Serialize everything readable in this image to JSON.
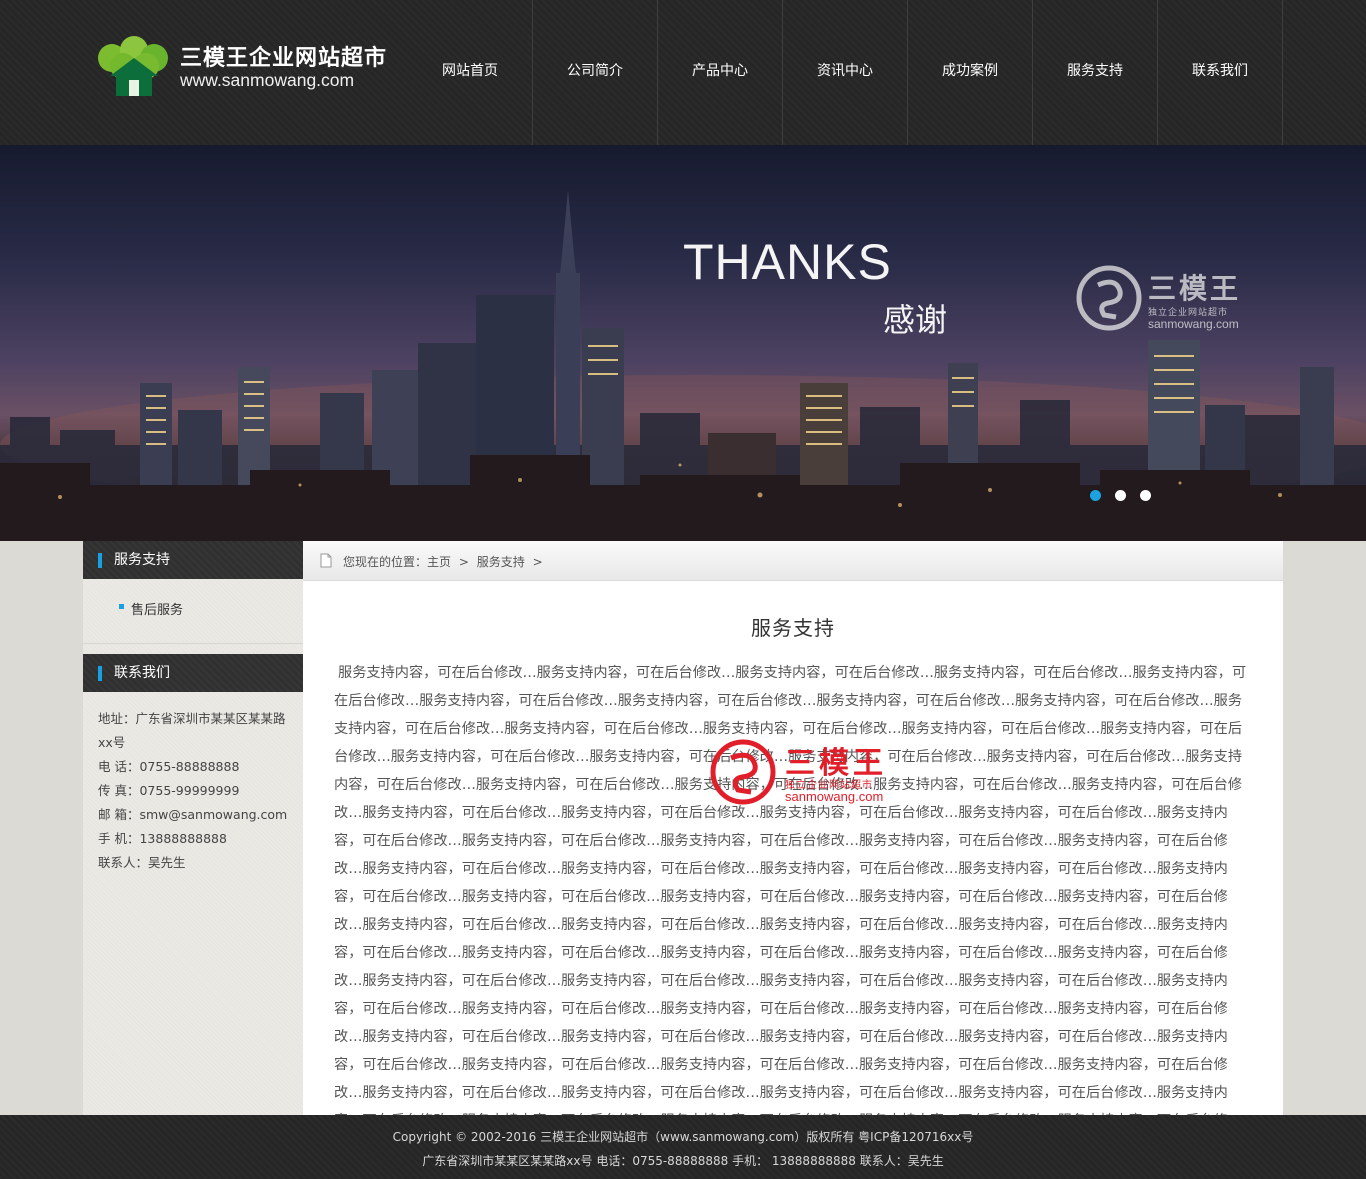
{
  "site": {
    "name_cn": "三模王企业网站超市",
    "url": "www.sanmowang.com"
  },
  "nav": {
    "items": [
      "网站首页",
      "公司简介",
      "产品中心",
      "资讯中心",
      "成功案例",
      "服务支持",
      "联系我们"
    ]
  },
  "banner": {
    "title": "THANKS",
    "subtitle": "感谢",
    "watermark": {
      "brand": "三模王",
      "tagline": "独立企业网站超市",
      "url": "sanmowang.com"
    },
    "slides": 3,
    "active_slide": 1
  },
  "sidebar": {
    "service_heading": "服务支持",
    "service_items": [
      "售后服务"
    ],
    "contact_heading": "联系我们",
    "contact": {
      "address": "地址：广东省深圳市某某区某某路xx号",
      "phone": "电 话：0755-88888888",
      "fax": "传 真：0755-99999999",
      "email": "邮 箱：smw@sanmowang.com",
      "mobile": "手 机：13888888888",
      "person": "联系人：吴先生"
    }
  },
  "breadcrumb": {
    "prefix": "您现在的位置：",
    "home": "主页",
    "sep": ">",
    "current": "服务支持",
    "trail": ">"
  },
  "content": {
    "title": "服务支持",
    "body": "服务支持内容，可在后台修改…服务支持内容，可在后台修改…服务支持内容，可在后台修改…服务支持内容，可在后台修改…服务支持内容，可在后台修改…服务支持内容，可在后台修改…服务支持内容，可在后台修改…服务支持内容，可在后台修改…服务支持内容，可在后台修改…服务支持内容，可在后台修改…服务支持内容，可在后台修改…服务支持内容，可在后台修改…服务支持内容，可在后台修改…服务支持内容，可在后台修改…服务支持内容，可在后台修改…服务支持内容，可在后台修改…服务支持内容，可在后台修改…服务支持内容，可在后台修改…服务支持内容，可在后台修改…服务支持内容，可在后台修改…服务支持内容，可在后台修改…服务支持内容，可在后台修改…服务支持内容，可在后台修改…服务支持内容，可在后台修改…服务支持内容，可在后台修改…服务支持内容，可在后台修改…服务支持内容，可在后台修改…服务支持内容，可在后台修改…服务支持内容，可在后台修改…服务支持内容，可在后台修改…服务支持内容，可在后台修改…服务支持内容，可在后台修改…服务支持内容，可在后台修改…服务支持内容，可在后台修改…服务支持内容，可在后台修改…服务支持内容，可在后台修改…服务支持内容，可在后台修改…服务支持内容，可在后台修改…服务支持内容，可在后台修改…服务支持内容，可在后台修改…服务支持内容，可在后台修改…服务支持内容，可在后台修改…服务支持内容，可在后台修改…服务支持内容，可在后台修改…服务支持内容，可在后台修改…服务支持内容，可在后台修改…服务支持内容，可在后台修改…服务支持内容，可在后台修改…服务支持内容，可在后台修改…服务支持内容，可在后台修改…服务支持内容，可在后台修改…服务支持内容，可在后台修改…服务支持内容，可在后台修改…服务支持内容，可在后台修改…服务支持内容，可在后台修改…服务支持内容，可在后台修改…服务支持内容，可在后台修改…服务支持内容，可在后台修改…服务支持内容，可在后台修改…服务支持内容，可在后台修改…服务支持内容，可在后台修改…服务支持内容，可在后台修改…服务支持内容，可在后台修改…服务支持内容，可在后台修改…服务支持内容，可在后台修改…服务支持内容，可在后台修改…服务支持内容，可在后台修改…服务支持内容，可在后台修改…服务支持内容，可在后台修改…服务支持内容，可在后台修改…服务支持内容，可在后台修改…服务支持内容，可在后台修改…服务支持内容，可在后台修改…服务支持内容，可在后台修改…服务支持内容，可在后台修改…服务支持内容，可在后台修改…服务支持内容，可在后台修改…",
    "watermark": {
      "brand": "三模王",
      "tagline": "独立企业网站超市",
      "url": "sanmowang.com"
    }
  },
  "footer": {
    "line1": "Copyright © 2002-2016 三模王企业网站超市（www.sanmowang.com）版权所有 粤ICP备120716xx号",
    "line2": "广东省深圳市某某区某某路xx号  电话：0755-88888888   手机： 13888888888   联系人：吴先生"
  },
  "colors": {
    "accent": "#18a0e2",
    "logo_green": "#6ab42d",
    "watermark_red": "#e01f2a",
    "header_bg": "#262626"
  }
}
